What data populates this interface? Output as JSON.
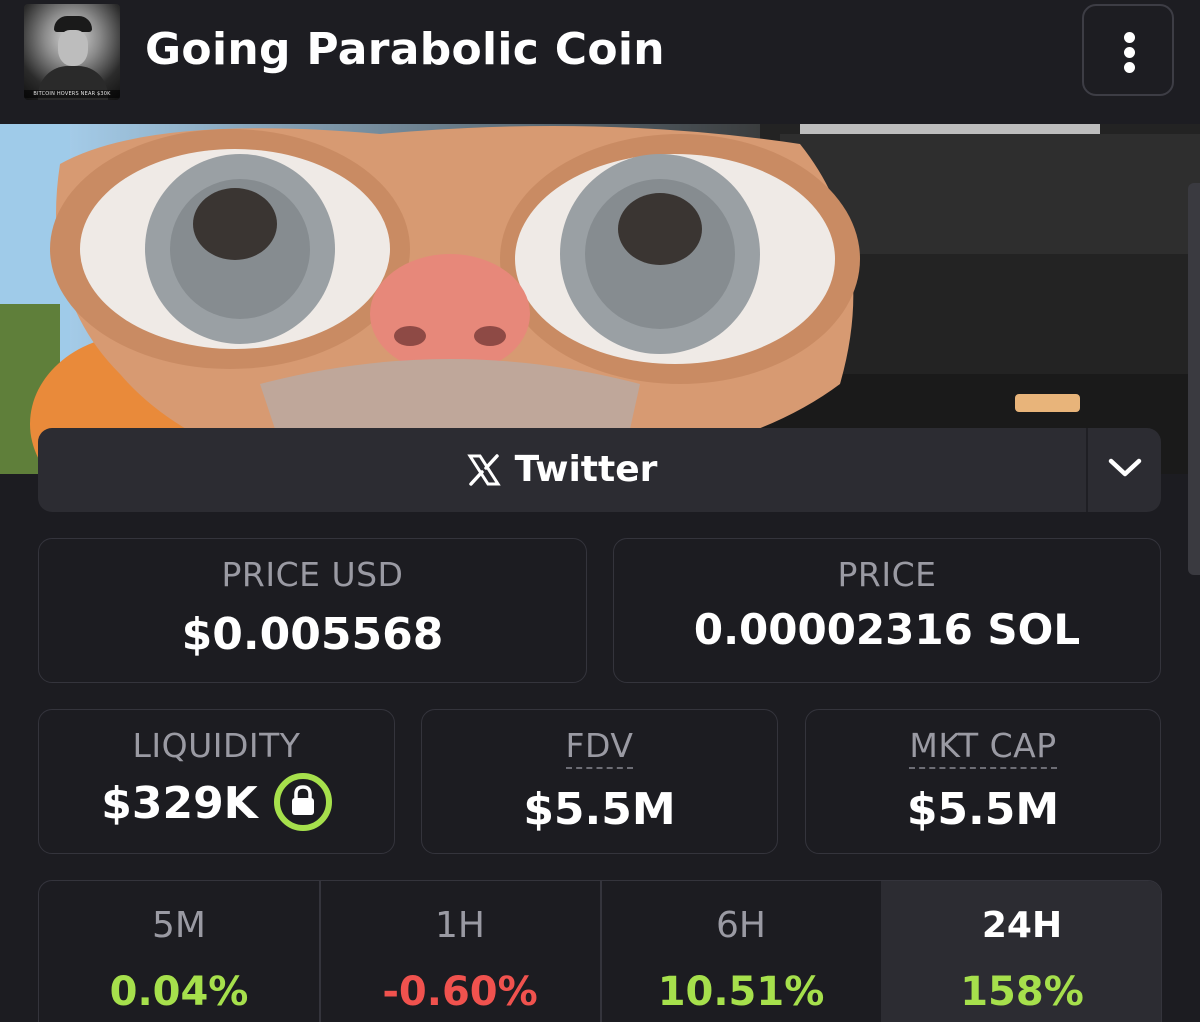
{
  "header": {
    "title": "Going Parabolic Coin",
    "avatar_caption": "BITCOIN HOVERS NEAR $30K",
    "menu_icon": "more-vertical-icon"
  },
  "social": {
    "twitter_label": "Twitter",
    "twitter_icon": "x-logo-icon",
    "dropdown_icon": "chevron-down-icon"
  },
  "price": {
    "usd_label": "PRICE USD",
    "usd_value": "$0.005568",
    "native_label": "PRICE",
    "native_value": "0.00002316 SOL"
  },
  "metrics": {
    "liquidity_label": "LIQUIDITY",
    "liquidity_value": "$329K",
    "liquidity_icon": "lock-icon",
    "fdv_label": "FDV",
    "fdv_value": "$5.5M",
    "mktcap_label": "MKT CAP",
    "mktcap_value": "$5.5M"
  },
  "timeframes": [
    {
      "label": "5M",
      "value": "0.04%",
      "direction": "up"
    },
    {
      "label": "1H",
      "value": "-0.60%",
      "direction": "down"
    },
    {
      "label": "6H",
      "value": "10.51%",
      "direction": "up"
    },
    {
      "label": "24H",
      "value": "158%",
      "direction": "up",
      "selected": true
    }
  ],
  "colors": {
    "background": "#1c1c21",
    "positive": "#a6e04c",
    "negative": "#f0524e",
    "muted_text": "#9a9aa3",
    "card_border": "#34343c",
    "selected_tab": "#2c2c32"
  }
}
